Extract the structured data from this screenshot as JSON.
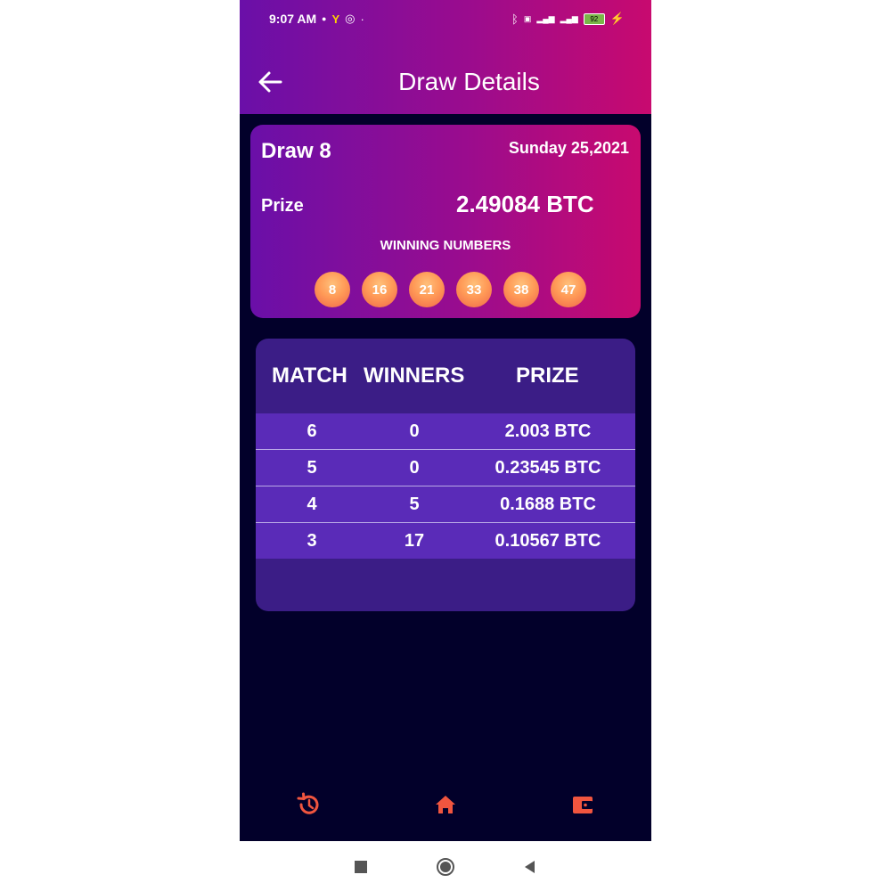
{
  "status_bar": {
    "time": "9:07 AM",
    "battery": "92"
  },
  "header": {
    "title": "Draw Details"
  },
  "draw": {
    "name": "Draw 8",
    "date": "Sunday 25,2021",
    "prize_label": "Prize",
    "prize_value": "2.49084 BTC",
    "winning_label": "WINNING NUMBERS",
    "numbers": [
      "8",
      "16",
      "21",
      "33",
      "38",
      "47"
    ]
  },
  "results_table": {
    "headers": [
      "MATCH",
      "WINNERS",
      "PRIZE"
    ],
    "rows": [
      {
        "match": "6",
        "winners": "0",
        "prize": "2.003 BTC"
      },
      {
        "match": "5",
        "winners": "0",
        "prize": "0.23545 BTC"
      },
      {
        "match": "4",
        "winners": "5",
        "prize": "0.1688 BTC"
      },
      {
        "match": "3",
        "winners": "17",
        "prize": "0.10567 BTC"
      }
    ]
  },
  "bottom_nav": {
    "items": [
      {
        "icon": "history-icon"
      },
      {
        "icon": "home-icon"
      },
      {
        "icon": "wallet-icon"
      }
    ]
  },
  "colors": {
    "background": "#02002a",
    "header_gradient_start": "#6a0fa8",
    "header_gradient_end": "#c80a6f",
    "table_bg": "#3b1d86",
    "row_bg": "#5a2bb8",
    "ball_orange": "#ff9a57",
    "nav_icon": "#f0553f"
  }
}
